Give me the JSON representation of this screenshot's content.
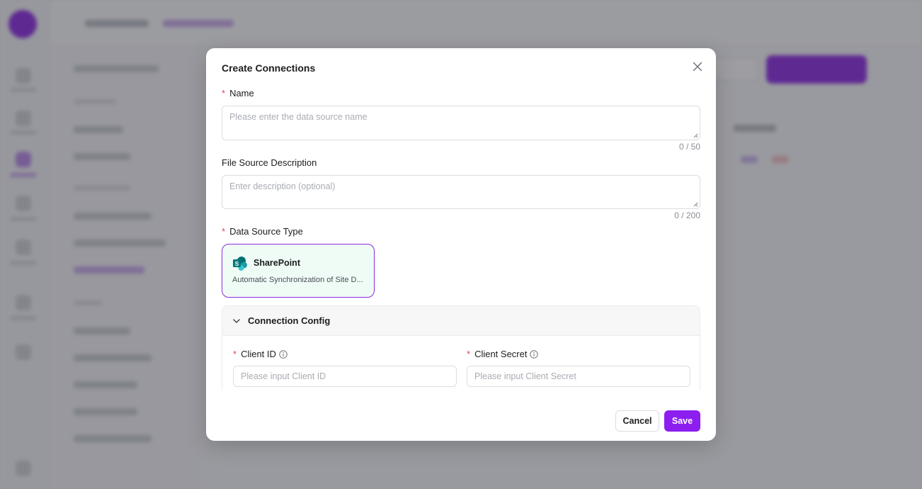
{
  "modal": {
    "title": "Create Connections",
    "name_field": {
      "label": "Name",
      "placeholder": "Please enter the data source name",
      "counter": "0 / 50"
    },
    "description_field": {
      "label": "File Source Description",
      "placeholder": "Enter description (optional)",
      "counter": "0 / 200"
    },
    "data_source_type": {
      "label": "Data Source Type",
      "selected": {
        "name": "SharePoint",
        "description": "Automatic Synchronization of Site D..."
      }
    },
    "connection_config": {
      "title": "Connection Config",
      "client_id": {
        "label": "Client ID",
        "placeholder": "Please input Client ID"
      },
      "client_secret": {
        "label": "Client Secret",
        "placeholder": "Please input Client Secret"
      }
    },
    "footer": {
      "cancel_label": "Cancel",
      "save_label": "Save"
    }
  },
  "colors": {
    "accent": "#8c1ef0",
    "required": "#e5484d",
    "card_bg": "#effbf5"
  }
}
